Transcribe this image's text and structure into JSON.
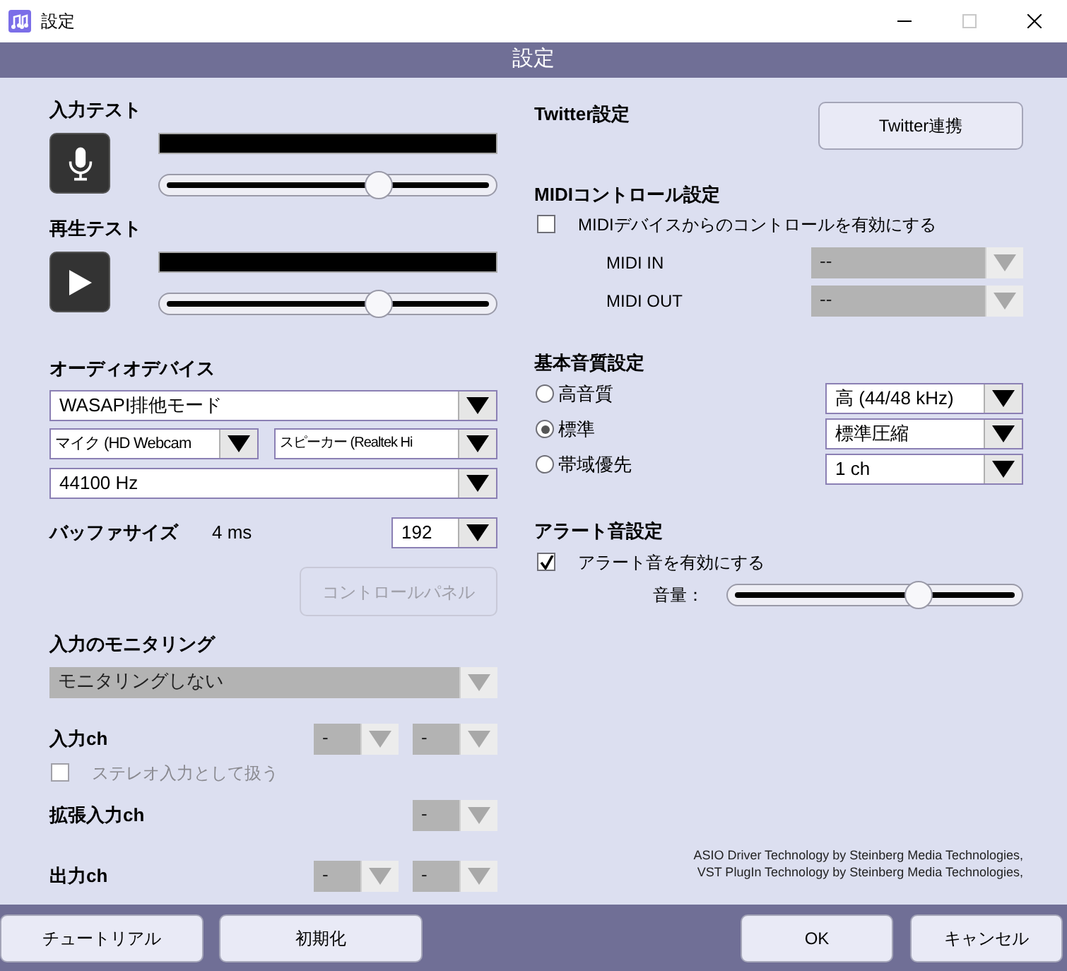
{
  "window": {
    "title": "設定"
  },
  "header": {
    "title": "設定"
  },
  "tests": [
    {
      "label": "入力テスト",
      "kind": "mic",
      "slider": {
        "level": 0.65
      }
    },
    {
      "label": "再生テスト",
      "kind": "play",
      "slider": {
        "level": 0.65
      }
    }
  ],
  "audio_device": {
    "title": "オーディオデバイス",
    "driver": {
      "value": "WASAPI排他モード",
      "disabled": false
    },
    "input": {
      "value": "マイク (HD Webcam",
      "disabled": false
    },
    "output": {
      "value": "スピーカー (Realtek Hi",
      "disabled": false
    },
    "sample_rate": {
      "value": "44100 Hz",
      "disabled": false
    },
    "buffer": {
      "label": "バッファサイズ",
      "latency": "4 ms",
      "select": {
        "value": "192",
        "disabled": false
      }
    },
    "control_panel": {
      "label": "コントロールパネル",
      "disabled": true
    }
  },
  "monitoring": {
    "title": "入力のモニタリング",
    "select": {
      "value": "モニタリングしない",
      "disabled": true
    }
  },
  "channels": [
    {
      "label": "入力ch",
      "selects": [
        {
          "value": "-",
          "disabled": true
        },
        {
          "value": "-",
          "disabled": true
        }
      ],
      "option": {
        "label": "ステレオ入力として扱う",
        "checked": false,
        "disabled": true
      }
    },
    {
      "label": "拡張入力ch",
      "selects": [
        {
          "value": "-",
          "disabled": true
        }
      ]
    },
    {
      "label": "出力ch",
      "selects": [
        {
          "value": "-",
          "disabled": true
        },
        {
          "value": "-",
          "disabled": true
        }
      ]
    }
  ],
  "twitter": {
    "title": "Twitter設定",
    "button": "Twitter連携"
  },
  "midi": {
    "title": "MIDIコントロール設定",
    "enable": {
      "label": "MIDIデバイスからのコントロールを有効にする",
      "checked": false,
      "disabled": false
    },
    "ports": [
      {
        "label": "MIDI IN",
        "select": {
          "value": "--",
          "disabled": true
        }
      },
      {
        "label": "MIDI OUT",
        "select": {
          "value": "--",
          "disabled": true
        }
      }
    ]
  },
  "quality": {
    "title": "基本音質設定",
    "options": [
      {
        "label": "高音質",
        "selected": false,
        "select": {
          "value": "高 (44/48 kHz)",
          "disabled": false
        }
      },
      {
        "label": "標準",
        "selected": true,
        "select": {
          "value": "標準圧縮",
          "disabled": false
        }
      },
      {
        "label": "帯域優先",
        "selected": false,
        "select": {
          "value": "1 ch",
          "disabled": false
        }
      }
    ]
  },
  "alert": {
    "title": "アラート音設定",
    "enable": {
      "label": "アラート音を有効にする",
      "checked": true,
      "disabled": false
    },
    "volume": {
      "label": "音量：",
      "level": 0.65
    }
  },
  "credits": [
    "ASIO Driver Technology by Steinberg Media Technologies,",
    "VST PlugIn Technology by Steinberg Media Technologies,"
  ],
  "footer": {
    "left_buttons": [
      "チュートリアル",
      "初期化"
    ],
    "right_buttons": [
      "OK",
      "キャンセル"
    ]
  }
}
